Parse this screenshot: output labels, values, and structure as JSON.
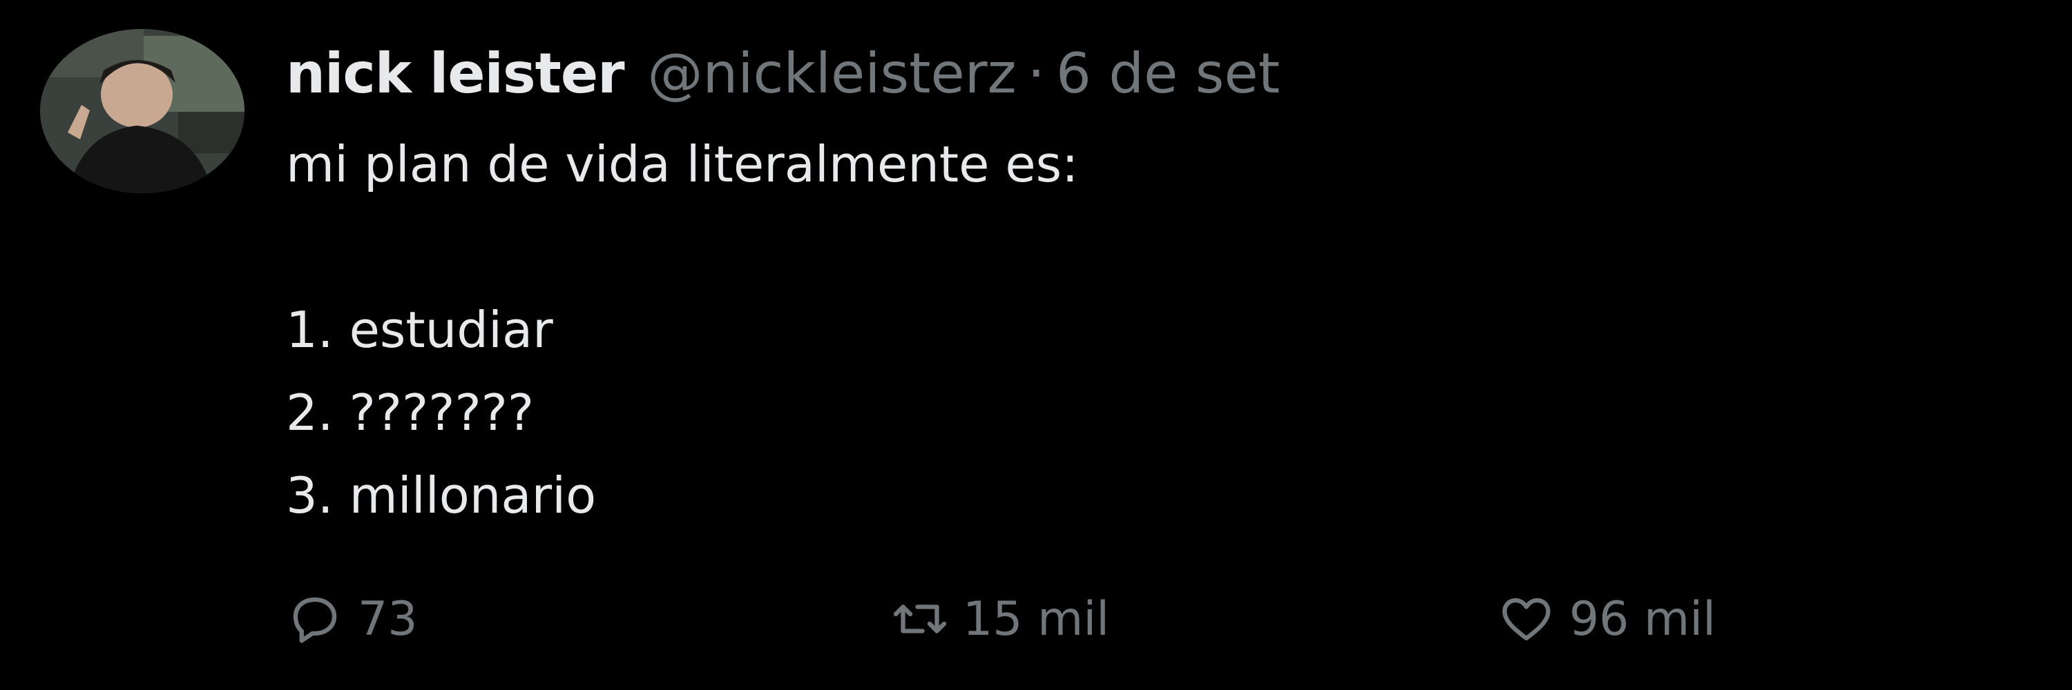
{
  "author": {
    "name": "nick leister",
    "handle": "@nickleisterz",
    "separator": "·",
    "date": "6 de set",
    "avatar_icon": "profile-photo"
  },
  "tweet": {
    "lines": [
      "mi plan de vida literalmente es:",
      "",
      "1. estudiar",
      "2. ???????",
      "3. millonario"
    ]
  },
  "actions": {
    "reply": {
      "icon": "reply-icon",
      "count": "73"
    },
    "retweet": {
      "icon": "retweet-icon",
      "count": "15 mil"
    },
    "like": {
      "icon": "heart-icon",
      "count": "96 mil"
    }
  },
  "colors": {
    "background": "#000000",
    "primary_text": "#e7e9ea",
    "secondary_text": "#71767b"
  }
}
